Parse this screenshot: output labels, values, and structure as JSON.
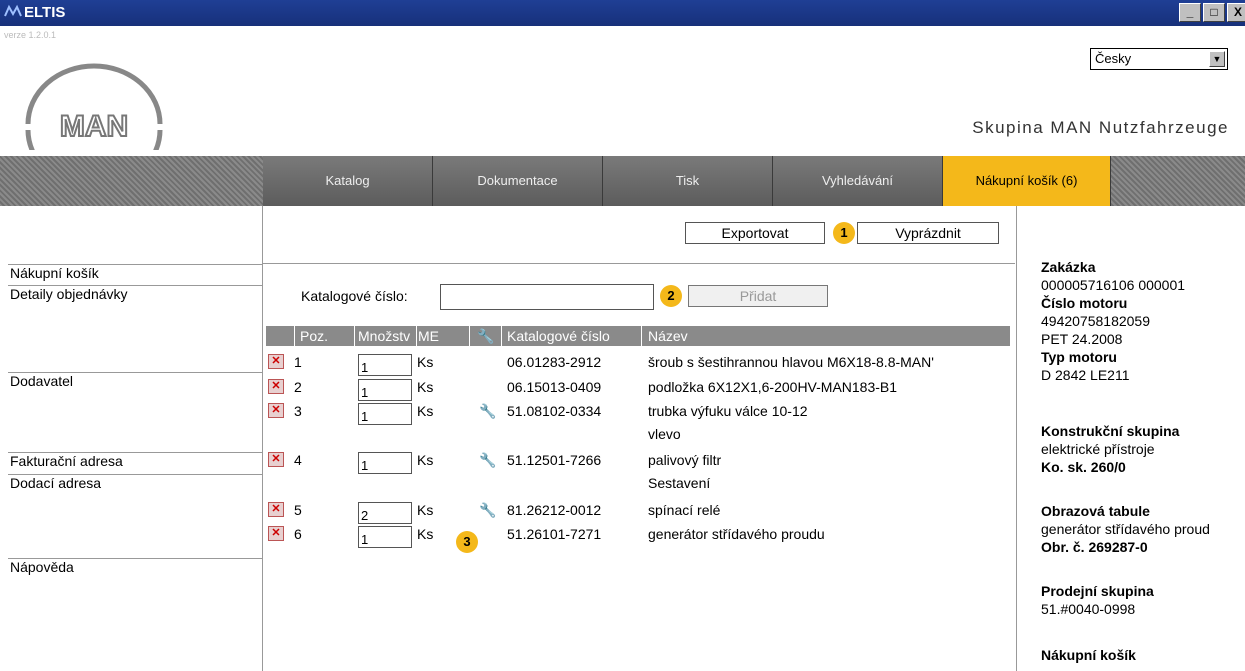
{
  "window": {
    "title": "ELTIS",
    "controls": [
      "_",
      "□",
      "X"
    ]
  },
  "header": {
    "version": "verze 1.2.0.1",
    "logo_text": "MAN",
    "language": "Česky",
    "group_name": "Skupina MAN Nutzfahrzeuge"
  },
  "nav": {
    "tabs": [
      "Katalog",
      "Dokumentace",
      "Tisk",
      "Vyhledávání",
      "Nákupní košík (6)"
    ],
    "active_index": 4
  },
  "sidebar": {
    "items": [
      "Nákupní košík",
      "Detaily objednávky",
      "Dodavatel",
      "Fakturační adresa",
      "Dodací adresa",
      "Nápověda"
    ]
  },
  "toolbar": {
    "export_label": "Exportovat",
    "empty_label": "Vyprázdnit",
    "badge1": "1"
  },
  "add_form": {
    "label": "Katalogové číslo:",
    "value": "",
    "add_label": "Přidat",
    "badge2": "2"
  },
  "table": {
    "headers": {
      "pos": "Poz.",
      "qty": "Množstv",
      "me": "ME",
      "catno": "Katalogové číslo",
      "name": "Název"
    },
    "rows": [
      {
        "pos": "1",
        "qty": "1",
        "me": "Ks",
        "tool": false,
        "catno": "06.01283-2912",
        "name": "šroub s šestihrannou hlavou M6X18-8.8-MAN'",
        "name2": ""
      },
      {
        "pos": "2",
        "qty": "1",
        "me": "Ks",
        "tool": false,
        "catno": "06.15013-0409",
        "name": "podložka 6X12X1,6-200HV-MAN183-B1",
        "name2": ""
      },
      {
        "pos": "3",
        "qty": "1",
        "me": "Ks",
        "tool": true,
        "catno": "51.08102-0334",
        "name": "trubka výfuku válce 10-12",
        "name2": "vlevo"
      },
      {
        "pos": "4",
        "qty": "1",
        "me": "Ks",
        "tool": true,
        "catno": "51.12501-7266",
        "name": "palivový filtr",
        "name2": "Sestavení"
      },
      {
        "pos": "5",
        "qty": "2",
        "me": "Ks",
        "tool": true,
        "catno": "81.26212-0012",
        "name": "spínací relé",
        "name2": ""
      },
      {
        "pos": "6",
        "qty": "1",
        "me": "Ks",
        "tool": false,
        "catno": "51.26101-7271",
        "name": "generátor střídavého proudu",
        "name2": ""
      }
    ],
    "badge3": "3"
  },
  "info": {
    "zakazka_title": "Zakázka",
    "zakazka_value": "000005716106 000001",
    "motor_no_label": "Číslo motoru",
    "motor_no_value": "49420758182059",
    "pet": "PET 24.2008",
    "motor_type_label": "Typ motoru",
    "motor_type_value": "D 2842 LE211",
    "konstr_title": "Konstrukční skupina",
    "konstr_value": "elektrické přístroje",
    "konstr_ko": "Ko. sk. 260/0",
    "obraz_title": "Obrazová tabule",
    "obraz_value": "generátor střídavého proud",
    "obraz_no": "Obr. č. 269287-0",
    "prodej_title": "Prodejní skupina",
    "prodej_value": "51.#0040-0998",
    "cart_title": "Nákupní košík"
  },
  "colors": {
    "accent": "#f4b81a",
    "titlebar": "#1f3f95",
    "nav": "#5c5c5c"
  }
}
